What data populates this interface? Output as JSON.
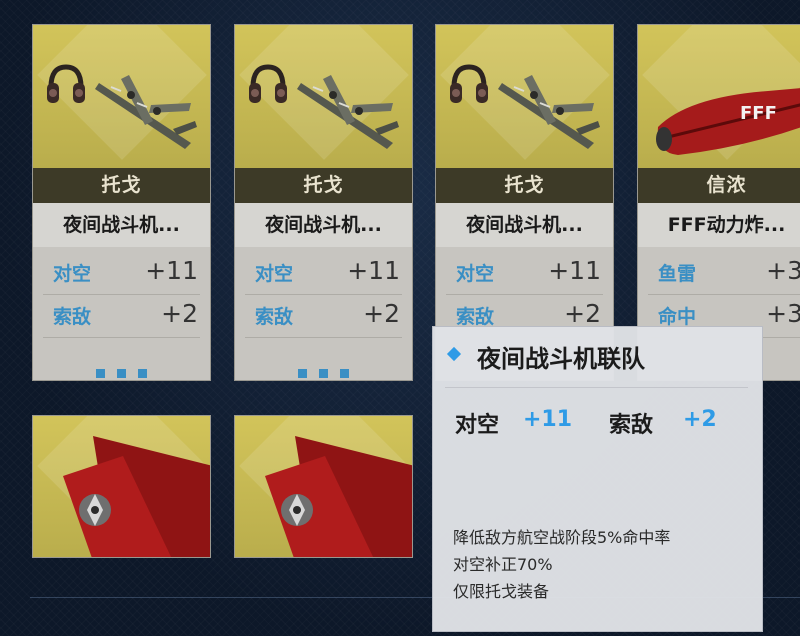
{
  "cards": [
    {
      "ship": "托戈",
      "equip_name": "夜间战斗机...",
      "stats": [
        {
          "name": "对空",
          "value": "+11"
        },
        {
          "name": "索敌",
          "value": "+2"
        }
      ]
    },
    {
      "ship": "托戈",
      "equip_name": "夜间战斗机...",
      "stats": [
        {
          "name": "对空",
          "value": "+11"
        },
        {
          "name": "索敌",
          "value": "+2"
        }
      ]
    },
    {
      "ship": "托戈",
      "equip_name": "夜间战斗机...",
      "stats": [
        {
          "name": "对空",
          "value": "+11"
        },
        {
          "name": "索敌",
          "value": "+2"
        }
      ]
    },
    {
      "ship": "信浓",
      "equip_name": "FFF动力炸...",
      "stats": [
        {
          "name": "鱼雷",
          "value": "+3"
        },
        {
          "name": "命中",
          "value": "+3"
        }
      ]
    }
  ],
  "tooltip": {
    "title": "夜间战斗机联队",
    "stats": [
      {
        "name": "对空",
        "value": "+11"
      },
      {
        "name": "索敌",
        "value": "+2"
      }
    ],
    "desc": [
      "降低敌方航空战阶段5%命中率",
      "对空补正70%",
      "仅限托戈装备"
    ]
  },
  "colors": {
    "accent": "#2f9be6",
    "card_image_bg": "#c9bd52",
    "name_bar": "#3d3a27"
  },
  "icons": {
    "tooltip_bullet": "diamond-icon",
    "more": "more-dots-icon"
  }
}
